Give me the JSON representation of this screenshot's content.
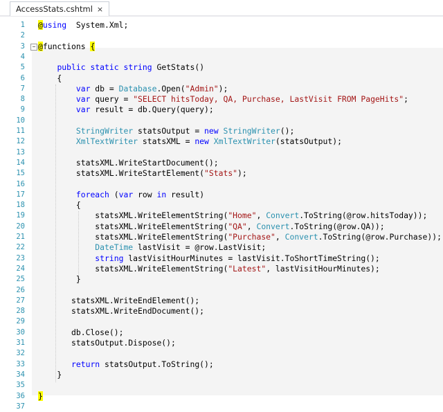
{
  "tab": {
    "title": "AccessStats.cshtml",
    "close": "×"
  },
  "code": {
    "lines": [
      {
        "n": "1",
        "t": [
          [
            "r",
            "@"
          ],
          [
            "kw",
            "using"
          ],
          [
            "",
            "  System.Xml;"
          ]
        ]
      },
      {
        "n": "2",
        "t": []
      },
      {
        "n": "3",
        "fold": "−",
        "t": [
          [
            "r",
            "@"
          ],
          [
            "",
            "functions "
          ],
          [
            "r",
            "{"
          ]
        ]
      },
      {
        "n": "4",
        "t": []
      },
      {
        "n": "5",
        "t": [
          [
            "",
            "    "
          ],
          [
            "kw",
            "public"
          ],
          [
            "",
            " "
          ],
          [
            "kw",
            "static"
          ],
          [
            "",
            " "
          ],
          [
            "kw",
            "string"
          ],
          [
            "",
            " GetStats()"
          ]
        ]
      },
      {
        "n": "6",
        "t": [
          [
            "",
            "    {"
          ]
        ]
      },
      {
        "n": "7",
        "t": [
          [
            "",
            "        "
          ],
          [
            "kw",
            "var"
          ],
          [
            "",
            " db = "
          ],
          [
            "ty",
            "Database"
          ],
          [
            "",
            ".Open("
          ],
          [
            "str",
            "\"Admin\""
          ],
          [
            "",
            ");"
          ]
        ]
      },
      {
        "n": "8",
        "t": [
          [
            "",
            "        "
          ],
          [
            "kw",
            "var"
          ],
          [
            "",
            " query = "
          ],
          [
            "str",
            "\"SELECT hitsToday, QA, Purchase, LastVisit FROM PageHits\""
          ],
          [
            "",
            ";"
          ]
        ]
      },
      {
        "n": "9",
        "t": [
          [
            "",
            "        "
          ],
          [
            "kw",
            "var"
          ],
          [
            "",
            " result = db.Query(query);"
          ]
        ]
      },
      {
        "n": "10",
        "t": []
      },
      {
        "n": "11",
        "t": [
          [
            "",
            "        "
          ],
          [
            "ty",
            "StringWriter"
          ],
          [
            "",
            " statsOutput = "
          ],
          [
            "kw",
            "new"
          ],
          [
            "",
            " "
          ],
          [
            "ty",
            "StringWriter"
          ],
          [
            "",
            "();"
          ]
        ]
      },
      {
        "n": "12",
        "t": [
          [
            "",
            "        "
          ],
          [
            "ty",
            "XmlTextWriter"
          ],
          [
            "",
            " statsXML = "
          ],
          [
            "kw",
            "new"
          ],
          [
            "",
            " "
          ],
          [
            "ty",
            "XmlTextWriter"
          ],
          [
            "",
            "(statsOutput);"
          ]
        ]
      },
      {
        "n": "13",
        "t": []
      },
      {
        "n": "14",
        "t": [
          [
            "",
            "        statsXML.WriteStartDocument();"
          ]
        ]
      },
      {
        "n": "15",
        "t": [
          [
            "",
            "        statsXML.WriteStartElement("
          ],
          [
            "str",
            "\"Stats\""
          ],
          [
            "",
            ");"
          ]
        ]
      },
      {
        "n": "16",
        "t": []
      },
      {
        "n": "17",
        "t": [
          [
            "",
            "        "
          ],
          [
            "kw",
            "foreach"
          ],
          [
            "",
            " ("
          ],
          [
            "kw",
            "var"
          ],
          [
            "",
            " row "
          ],
          [
            "kw",
            "in"
          ],
          [
            "",
            " result)"
          ]
        ]
      },
      {
        "n": "18",
        "t": [
          [
            "",
            "        {"
          ]
        ]
      },
      {
        "n": "19",
        "t": [
          [
            "",
            "            statsXML.WriteElementString("
          ],
          [
            "str",
            "\"Home\""
          ],
          [
            "",
            ", "
          ],
          [
            "ty",
            "Convert"
          ],
          [
            "",
            ".ToString(@row.hitsToday));"
          ]
        ]
      },
      {
        "n": "20",
        "t": [
          [
            "",
            "            statsXML.WriteElementString("
          ],
          [
            "str",
            "\"QA\""
          ],
          [
            "",
            ", "
          ],
          [
            "ty",
            "Convert"
          ],
          [
            "",
            ".ToString(@row.QA));"
          ]
        ]
      },
      {
        "n": "21",
        "t": [
          [
            "",
            "            statsXML.WriteElementString("
          ],
          [
            "str",
            "\"Purchase\""
          ],
          [
            "",
            ", "
          ],
          [
            "ty",
            "Convert"
          ],
          [
            "",
            ".ToString(@row.Purchase));"
          ]
        ]
      },
      {
        "n": "22",
        "t": [
          [
            "",
            "            "
          ],
          [
            "ty",
            "DateTime"
          ],
          [
            "",
            " lastVisit = @row.LastVisit;"
          ]
        ]
      },
      {
        "n": "23",
        "t": [
          [
            "",
            "            "
          ],
          [
            "kw",
            "string"
          ],
          [
            "",
            " lastVisitHourMinutes = lastVisit.ToShortTimeString();"
          ]
        ]
      },
      {
        "n": "24",
        "t": [
          [
            "",
            "            statsXML.WriteElementString("
          ],
          [
            "str",
            "\"Latest\""
          ],
          [
            "",
            ", lastVisitHourMinutes);"
          ]
        ]
      },
      {
        "n": "25",
        "t": [
          [
            "",
            "        }"
          ]
        ]
      },
      {
        "n": "26",
        "t": []
      },
      {
        "n": "27",
        "t": [
          [
            "",
            "       statsXML.WriteEndElement();"
          ]
        ]
      },
      {
        "n": "28",
        "t": [
          [
            "",
            "       statsXML.WriteEndDocument();"
          ]
        ]
      },
      {
        "n": "29",
        "t": []
      },
      {
        "n": "30",
        "t": [
          [
            "",
            "       db.Close();"
          ]
        ]
      },
      {
        "n": "31",
        "t": [
          [
            "",
            "       statsOutput.Dispose();"
          ]
        ]
      },
      {
        "n": "32",
        "t": []
      },
      {
        "n": "33",
        "t": [
          [
            "",
            "       "
          ],
          [
            "kw",
            "return"
          ],
          [
            "",
            " statsOutput.ToString();"
          ]
        ]
      },
      {
        "n": "34",
        "t": [
          [
            "",
            "    }"
          ]
        ]
      },
      {
        "n": "35",
        "t": []
      },
      {
        "n": "36",
        "t": [
          [
            "r",
            "}"
          ]
        ]
      },
      {
        "n": "37",
        "t": []
      }
    ]
  },
  "colors": {
    "keyword": "#0000ff",
    "type": "#2b91af",
    "string": "#a31515",
    "razor": "#ffff00",
    "line_number": "#2b91af"
  }
}
